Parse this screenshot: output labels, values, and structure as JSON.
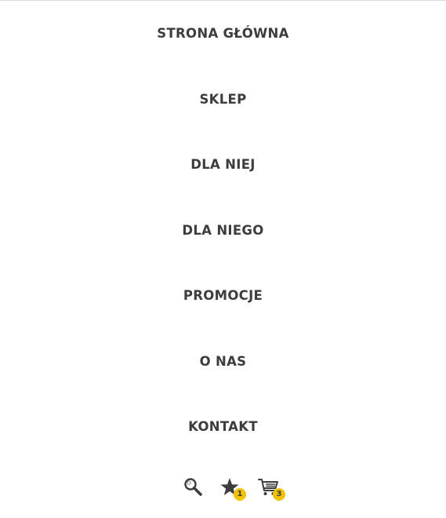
{
  "menu": {
    "items": [
      {
        "label": "STRONA GŁÓWNA"
      },
      {
        "label": "SKLEP"
      },
      {
        "label": "DLA NIEJ"
      },
      {
        "label": "DLA NIEGO"
      },
      {
        "label": "PROMOCJE"
      },
      {
        "label": "O NAS"
      },
      {
        "label": "KONTAKT"
      }
    ]
  },
  "toolbar": {
    "search": {
      "icon": "search-icon"
    },
    "wishlist": {
      "icon": "star-icon",
      "count": "1"
    },
    "cart": {
      "icon": "cart-icon",
      "count": "3"
    }
  },
  "colors": {
    "text": "#3d3d3d",
    "badge": "#f2c200",
    "divider": "#dcdcdc",
    "background": "#ffffff"
  }
}
